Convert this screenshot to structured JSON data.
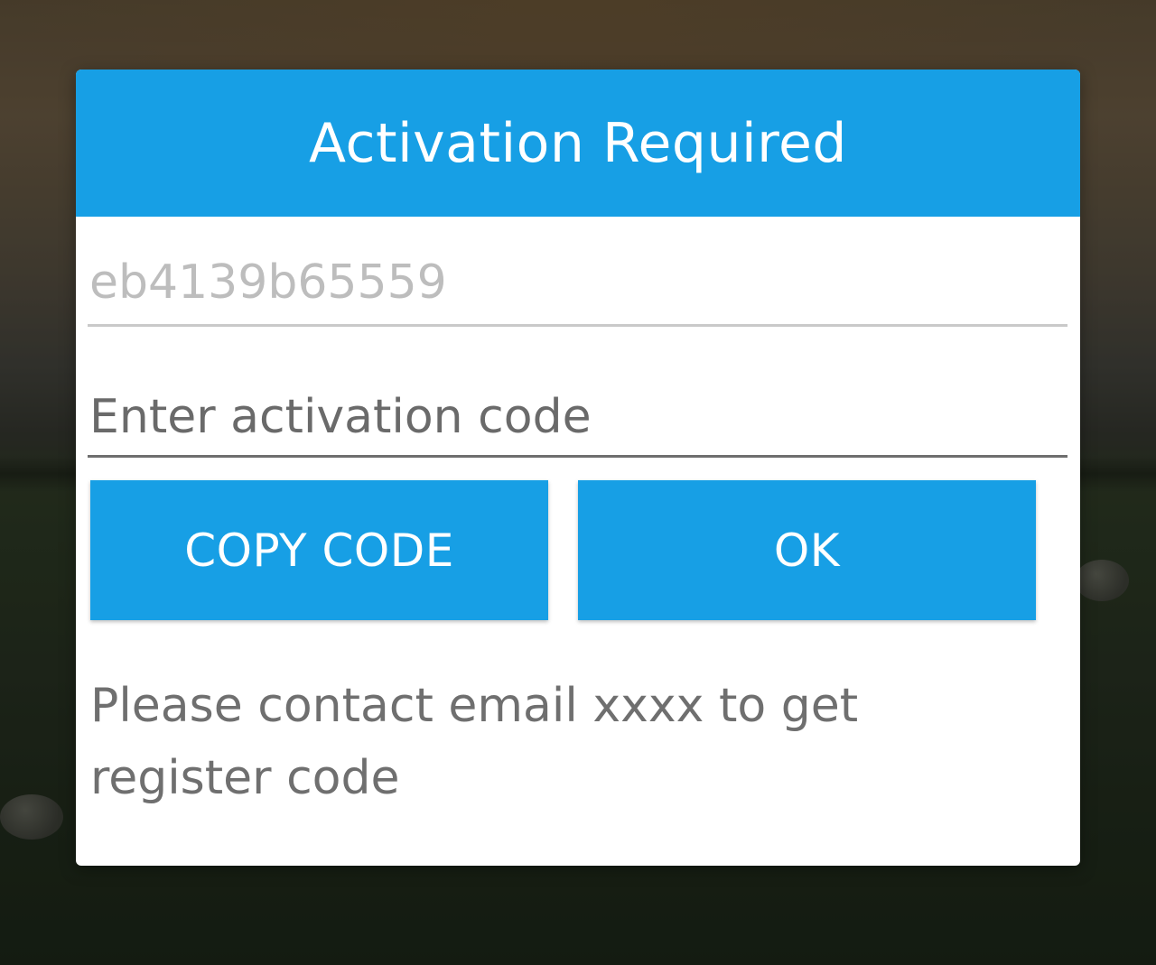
{
  "dialog": {
    "title": "Activation Required",
    "device_code": "eb4139b65559",
    "activation_input": {
      "value": "",
      "placeholder": "Enter activation code"
    },
    "buttons": {
      "copy_code": "COPY CODE",
      "ok": "OK"
    },
    "note": "Please contact email xxxx to get register code"
  },
  "colors": {
    "accent": "#179fe5",
    "dialog_background": "#ffffff",
    "muted_text": "#bdbdbd",
    "body_text": "#6f6f6f"
  }
}
